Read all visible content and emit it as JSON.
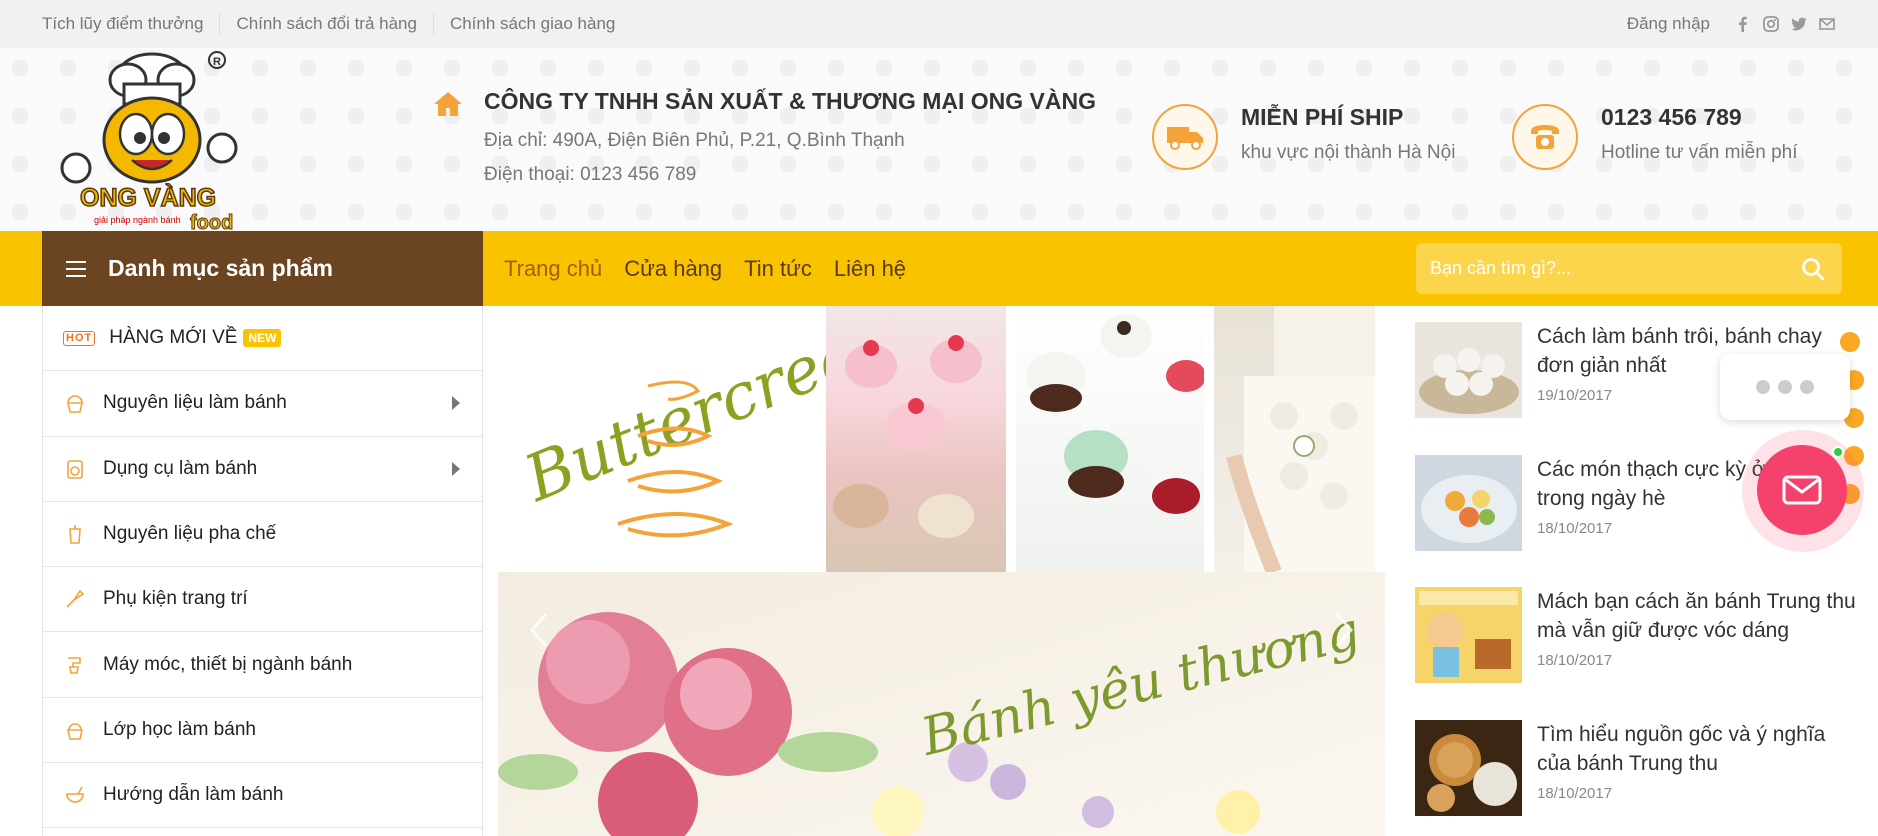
{
  "topbar": {
    "links": [
      "Tích lũy điểm thưởng",
      "Chính sách đổi trả hàng",
      "Chính sách giao hàng"
    ],
    "login": "Đăng nhập",
    "social": [
      "facebook-icon",
      "instagram-icon",
      "twitter-icon",
      "email-icon"
    ]
  },
  "header": {
    "company_name": "CÔNG TY TNHH SẢN XUẤT & THƯƠNG MẠI ONG VÀNG",
    "address": "Địa chỉ: 490A, Điện Biên Phủ, P.21, Q.Bình Thạnh",
    "phone": "Điện thoại: 0123 456 789",
    "ship_title": "MIỄN PHÍ SHIP",
    "ship_sub": "khu vực nội thành Hà Nội",
    "hotline_title": "0123 456 789",
    "hotline_sub": "Hotline tư vấn miễn phí"
  },
  "logo": {
    "brand": "ONG VÀNG",
    "tagline": "giải pháp ngành bánh",
    "food": "food"
  },
  "nav": {
    "category_label": "Danh mục sản phẩm",
    "menu": [
      "Trang chủ",
      "Cửa hàng",
      "Tin tức",
      "Liên hệ"
    ],
    "search_placeholder": "Bạn cần tìm gì?..."
  },
  "sidebar": {
    "hot_badge": "HOT",
    "new_badge": "NEW",
    "items": [
      {
        "label": "HÀNG MỚI VỀ"
      },
      {
        "label": "Nguyên liệu làm bánh"
      },
      {
        "label": "Dụng cụ làm bánh"
      },
      {
        "label": "Nguyên liệu pha chế"
      },
      {
        "label": "Phụ kiện trang trí"
      },
      {
        "label": "Máy móc, thiết bị ngành bánh"
      },
      {
        "label": "Lớp học làm bánh"
      },
      {
        "label": "Hướng dẫn làm bánh"
      }
    ]
  },
  "banner": {
    "buttercream_text": "Buttercream",
    "slide_text": "Bánh yêu thương"
  },
  "news": [
    {
      "title": "Cách làm bánh trôi, bánh chay đơn giản nhất",
      "date": "19/10/2017"
    },
    {
      "title": "Các món thạch cực kỳ ở Hà Nội trong ngày hè",
      "date": "18/10/2017"
    },
    {
      "title": "Mách bạn cách ăn bánh Trung thu mà vẫn giữ được vóc dáng",
      "date": "18/10/2017"
    },
    {
      "title": "Tìm hiểu nguồn gốc và ý nghĩa của bánh Trung thu",
      "date": "18/10/2017"
    }
  ],
  "colors": {
    "accent": "#f9c300",
    "brown": "#6b4522",
    "orange": "#f4a33a",
    "chat": "#f5426c"
  }
}
